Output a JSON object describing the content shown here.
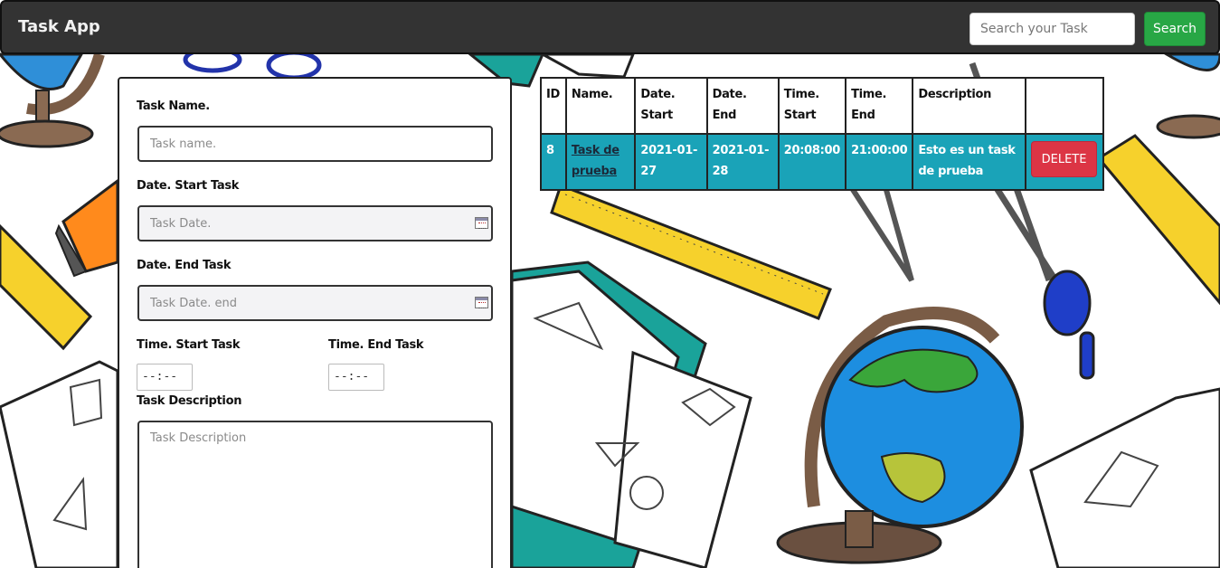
{
  "navbar": {
    "brand": "Task App",
    "search_placeholder": "Search your Task",
    "search_button": "Search"
  },
  "form": {
    "task_name_label": "Task Name.",
    "task_name_placeholder": "Task name.",
    "date_start_label": "Date. Start Task",
    "date_start_placeholder": "Task Date.",
    "date_end_label": "Date. End Task",
    "date_end_placeholder": "Task Date. end",
    "time_start_label": "Time. Start Task",
    "time_start_value": "--:--",
    "time_end_label": "Time. End Task",
    "time_end_value": "--:--",
    "description_label": "Task Description",
    "description_placeholder": "Task Description"
  },
  "table": {
    "headers": [
      "ID",
      "Name.",
      "Date. Start",
      "Date. End",
      "Time. Start",
      "Time. End",
      "Description",
      ""
    ],
    "rows": [
      {
        "id": "8",
        "name": "Task de prueba",
        "date_start": "2021-01-27",
        "date_end": "2021-01-28",
        "time_start": "20:08:00",
        "time_end": "21:00:00",
        "description": "Esto es un task de prueba",
        "action": "DELETE"
      }
    ]
  },
  "colors": {
    "navbar": "#333333",
    "search_button": "#28a745",
    "row_background": "#1aa3b8",
    "delete_button": "#dc3545"
  }
}
